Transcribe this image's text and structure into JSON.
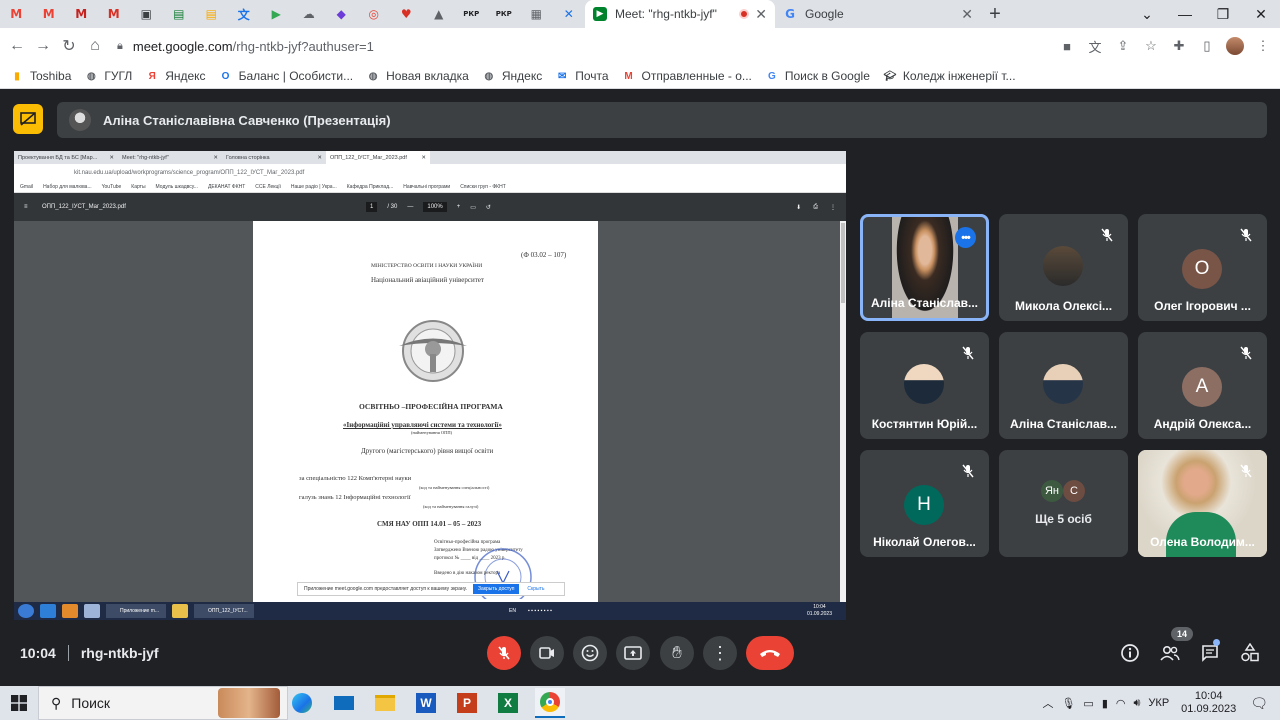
{
  "browser": {
    "pinned_tabs": [
      {
        "icon": "gmail-icon",
        "glyph": "M",
        "color": "#ea4335"
      },
      {
        "icon": "gmail-icon",
        "glyph": "M",
        "color": "#ea4335"
      },
      {
        "icon": "gmail-icon",
        "glyph": "M",
        "color": "#c5221f"
      },
      {
        "icon": "gmail-icon",
        "glyph": "M",
        "color": "#d93025"
      },
      {
        "icon": "contacts-icon",
        "glyph": "▣",
        "color": "#3c4043"
      },
      {
        "icon": "classroom-icon",
        "glyph": "▤",
        "color": "#188038"
      },
      {
        "icon": "classroom-icon",
        "glyph": "▤",
        "color": "#f9ab00"
      },
      {
        "icon": "translate-icon",
        "glyph": "文",
        "color": "#1a73e8"
      },
      {
        "icon": "naurok-icon",
        "glyph": "▶",
        "color": "#34a853"
      },
      {
        "icon": "cloud-icon",
        "glyph": "☁",
        "color": "#5f6368"
      },
      {
        "icon": "mindmap-icon",
        "glyph": "◆",
        "color": "#6c3bd8"
      },
      {
        "icon": "target-icon",
        "glyph": "◎",
        "color": "#ea4335"
      },
      {
        "icon": "heart-icon",
        "glyph": "♥",
        "color": "#d93025"
      },
      {
        "icon": "drive-icon",
        "glyph": "▲",
        "color": "#5f6368"
      },
      {
        "icon": "pkf-icon",
        "glyph": "РКР",
        "color": "#202124"
      },
      {
        "icon": "pkf-icon",
        "glyph": "РКР",
        "color": "#202124"
      },
      {
        "icon": "board-icon",
        "glyph": "▦",
        "color": "#5f6368"
      },
      {
        "icon": "x-icon",
        "glyph": "✕",
        "color": "#1a73e8"
      }
    ],
    "active_tab": "Meet: \"rhg-ntkb-jyf\"",
    "other_tab": "Google",
    "new_tab": "+",
    "url_host": "meet.google.com",
    "url_path": "/rhg-ntkb-jyf?authuser=1",
    "bookmarks": [
      {
        "label": "Toshiba",
        "icon": "folder-icon"
      },
      {
        "label": "ГУГЛ",
        "icon": "globe-icon"
      },
      {
        "label": "Яндекс",
        "icon": "yandex-icon"
      },
      {
        "label": "Баланс | Особисти...",
        "icon": "bank-icon"
      },
      {
        "label": "Новая вкладка",
        "icon": "globe-icon"
      },
      {
        "label": "Яндекс",
        "icon": "globe-icon"
      },
      {
        "label": "Почта",
        "icon": "mail-icon"
      },
      {
        "label": "Отправленные - о...",
        "icon": "gmail-icon"
      },
      {
        "label": "Поиск в Google",
        "icon": "google-icon"
      },
      {
        "label": "Коледж інженерії т...",
        "icon": "graduation-icon"
      }
    ]
  },
  "meet": {
    "presentation_title": "Аліна Станіславівна Савченко (Презентація)",
    "participants": [
      {
        "name": "Аліна Станіслав...",
        "type": "video",
        "speaking": true,
        "muted": false
      },
      {
        "name": "Микола Олексі...",
        "type": "photo",
        "muted": true
      },
      {
        "name": "Олег Ігорович ...",
        "type": "letter",
        "letter": "О",
        "color": "#795548",
        "muted": true
      },
      {
        "name": "Костянтин Юрій...",
        "type": "photo",
        "muted": true
      },
      {
        "name": "Аліна Станіслав...",
        "type": "photo",
        "muted": false
      },
      {
        "name": "Андрій Олекса...",
        "type": "letter",
        "letter": "А",
        "color": "#8d6e63",
        "muted": true
      },
      {
        "name": "Ніколай Олегов...",
        "type": "letter",
        "letter": "Н",
        "color": "#00695c",
        "muted": true
      },
      {
        "name": "Ще 5 осіб",
        "type": "more",
        "avatars": [
          "Ян",
          "С"
        ]
      },
      {
        "name": "Олена Володим...",
        "type": "video",
        "muted": true
      }
    ],
    "time": "10:04",
    "meeting_code": "rhg-ntkb-jyf",
    "people_count": "14"
  },
  "shared_screen": {
    "tabs": [
      "Проектування БД та БС [Мар...",
      "Meet: \"rhg-ntkb-jyf\"",
      "Головна сторінка",
      "ОПП_122_ІУСТ_Маг_2023.pdf"
    ],
    "url": "kit.nau.edu.ua/upload/workprograms/science_program/ОПП_122_ІУСТ_Маг_2023.pdf",
    "bookmarks": [
      "Gmail",
      "Набор для малюва...",
      "YouTube",
      "Карты",
      "Модуль шкадвсу...",
      "ДЕКАНАТ ФКНТ",
      "ССЕ Лекції",
      "Наше радіо | Укра...",
      "Кафедра Приклад...",
      "Навчальні програми",
      "Списки груп - ФКНТ"
    ],
    "pdf_name": "ОПП_122_ІУСТ_Маг_2023.pdf",
    "pdf_page": "1",
    "pdf_pages": "/ 30",
    "pdf_zoom": "100%",
    "doc_code": "(Ф 03.02 – 107)",
    "doc_lines": [
      "МІНІСТЕРСТВО ОСВІТИ І НАУКИ УКРАЇНИ",
      "Національний авіаційний університет",
      "ОСВІТНЬО –ПРОФЕСІЙНА ПРОГРАМА",
      "«Інформаційні управляючі системи та технології»",
      "(найменування ОПП)",
      "Другого (магістерського) рівня вищої освіти",
      "за спеціальністю 122 Комп'ютерні науки",
      "(код та найменування спеціальності)",
      "галузь знань   12 Інформаційні технології",
      "(код та найменування галузі)",
      "СМЯ НАУ ОПП 14.01 – 05 – 2023",
      "Освітньо-професійна програма",
      "Затверджено Вченою радою університету",
      "протокол № ____ від ____ 2023 р.",
      "Введено в дію наказом ректора"
    ],
    "share_notice": "Приложение meet.google.com предоставляет доступ к вашему экрану.",
    "share_stop": "Закрыть доступ",
    "share_hide": "Скрыть",
    "taskbar_items": [
      "Приложение m...",
      "ОПП_122_ІУСТ..."
    ],
    "tray_lang": "EN",
    "tray_time": "10:04",
    "tray_date": "01.09.2023"
  },
  "windows": {
    "search_placeholder": "Поиск",
    "lang": "УКР",
    "time": "10:04",
    "date": "01.09.2023"
  }
}
